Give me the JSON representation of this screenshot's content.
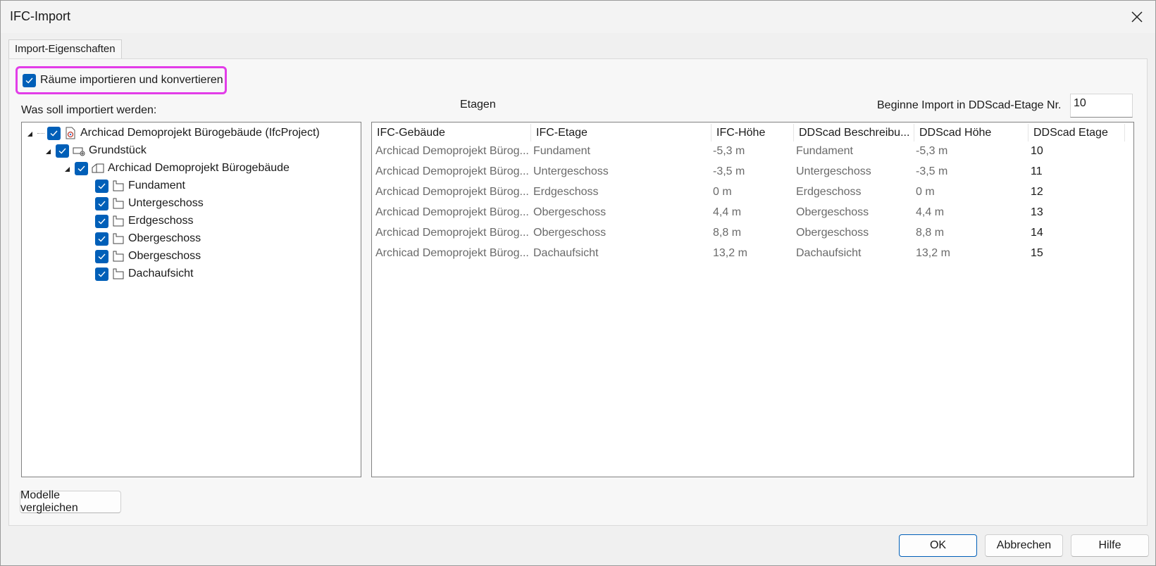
{
  "window": {
    "title": "IFC-Import"
  },
  "tabs": [
    {
      "label": "Import-Eigenschaften"
    }
  ],
  "options": {
    "import_rooms_label": "Räume importieren und konvertieren",
    "import_rooms_checked": true
  },
  "labels": {
    "what_import": "Was soll importiert werden:",
    "etagen": "Etagen",
    "begin_import": "Beginne Import in DDScad-Etage Nr."
  },
  "start_etage_value": "10",
  "tree": [
    {
      "label": "Archicad Demoprojekt Bürogebäude (IfcProject)",
      "icon": "project-icon",
      "checked": true,
      "expanded": true
    },
    {
      "label": "Grundstück",
      "icon": "site-icon",
      "checked": true,
      "expanded": true
    },
    {
      "label": "Archicad Demoprojekt Bürogebäude",
      "icon": "building-icon",
      "checked": true,
      "expanded": true
    },
    {
      "label": "Fundament",
      "icon": "storey-icon",
      "checked": true
    },
    {
      "label": "Untergeschoss",
      "icon": "storey-icon",
      "checked": true
    },
    {
      "label": "Erdgeschoss",
      "icon": "storey-icon",
      "checked": true
    },
    {
      "label": "Obergeschoss",
      "icon": "storey-icon",
      "checked": true
    },
    {
      "label": "Obergeschoss",
      "icon": "storey-icon",
      "checked": true
    },
    {
      "label": "Dachaufsicht",
      "icon": "storey-icon",
      "checked": true
    }
  ],
  "grid": {
    "columns": [
      "IFC-Gebäude",
      "IFC-Etage",
      "IFC-Höhe",
      "DDScad Beschreibu...",
      "DDScad Höhe",
      "DDScad Etage"
    ],
    "rows": [
      [
        "Archicad Demoprojekt Bürog...",
        "Fundament",
        "-5,3 m",
        "Fundament",
        "-5,3 m",
        "10"
      ],
      [
        "Archicad Demoprojekt Bürog...",
        "Untergeschoss",
        "-3,5 m",
        "Untergeschoss",
        "-3,5 m",
        "11"
      ],
      [
        "Archicad Demoprojekt Bürog...",
        "Erdgeschoss",
        "0 m",
        "Erdgeschoss",
        "0 m",
        "12"
      ],
      [
        "Archicad Demoprojekt Bürog...",
        "Obergeschoss",
        "4,4 m",
        "Obergeschoss",
        "4,4 m",
        "13"
      ],
      [
        "Archicad Demoprojekt Bürog...",
        "Obergeschoss",
        "8,8 m",
        "Obergeschoss",
        "8,8 m",
        "14"
      ],
      [
        "Archicad Demoprojekt Bürog...",
        "Dachaufsicht",
        "13,2 m",
        "Dachaufsicht",
        "13,2 m",
        "15"
      ]
    ]
  },
  "buttons": {
    "compare": "Modelle vergleichen",
    "ok": "OK",
    "cancel": "Abbrechen",
    "help": "Hilfe"
  },
  "colors": {
    "accent": "#005fb8",
    "highlight": "#e23de8"
  }
}
